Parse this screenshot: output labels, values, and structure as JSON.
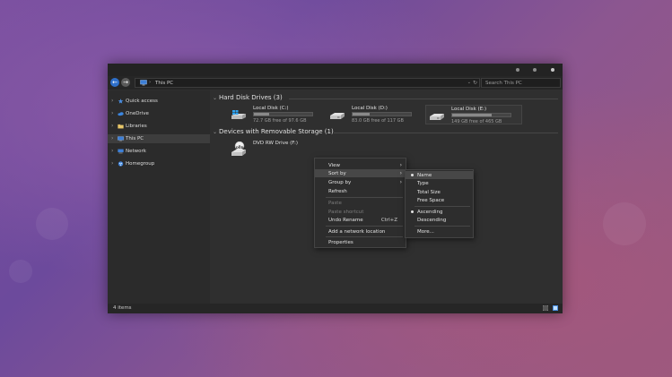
{
  "address": {
    "location": "This PC"
  },
  "search": {
    "placeholder": "Search This PC"
  },
  "sidebar": {
    "items": [
      {
        "label": "Quick access",
        "icon": "star-icon"
      },
      {
        "label": "OneDrive",
        "icon": "cloud-icon"
      },
      {
        "label": "Libraries",
        "icon": "folder-icon"
      },
      {
        "label": "This PC",
        "icon": "computer-icon",
        "selected": true
      },
      {
        "label": "Network",
        "icon": "network-icon"
      },
      {
        "label": "Homegroup",
        "icon": "homegroup-icon"
      }
    ]
  },
  "groups": {
    "hard_disk": {
      "title": "Hard Disk Drives (3)"
    },
    "removable": {
      "title": "Devices with Removable Storage (1)"
    }
  },
  "drives": [
    {
      "name": "Local Disk (C:)",
      "free_text": "72.7 GB free of 97.6 GB",
      "used_fraction": 0.26,
      "icon": "windows-drive-icon"
    },
    {
      "name": "Local Disk (D:)",
      "free_text": "83.0 GB free of 117 GB",
      "used_fraction": 0.29,
      "icon": "hard-drive-icon"
    },
    {
      "name": "Local Disk (E:)",
      "free_text": "149 GB free of 465 GB",
      "used_fraction": 0.68,
      "icon": "hard-drive-icon",
      "selected": true
    }
  ],
  "dvd": {
    "name": "DVD RW Drive (F:)",
    "icon": "dvd-drive-icon",
    "badge": "DVD"
  },
  "status": {
    "items_count": "4 items"
  },
  "context_menu": {
    "items": [
      {
        "label": "View",
        "submenu": true
      },
      {
        "label": "Sort by",
        "submenu": true,
        "highlighted": true
      },
      {
        "label": "Group by",
        "submenu": true
      },
      {
        "label": "Refresh"
      },
      {
        "label": "Paste",
        "disabled": true
      },
      {
        "label": "Paste shortcut",
        "disabled": true
      },
      {
        "label": "Undo Rename",
        "shortcut": "Ctrl+Z"
      },
      {
        "label": "Add a network location"
      },
      {
        "label": "Properties"
      }
    ]
  },
  "sort_menu": {
    "items": [
      {
        "label": "Name",
        "checked": true,
        "highlighted": true
      },
      {
        "label": "Type"
      },
      {
        "label": "Total Size"
      },
      {
        "label": "Free Space"
      },
      {
        "label": "Ascending",
        "checked": true
      },
      {
        "label": "Descending"
      },
      {
        "label": "More..."
      }
    ]
  },
  "colors": {
    "accent": "#2e6fc9",
    "window_bg": "#2f2f2f",
    "menu_highlight": "#474747"
  }
}
